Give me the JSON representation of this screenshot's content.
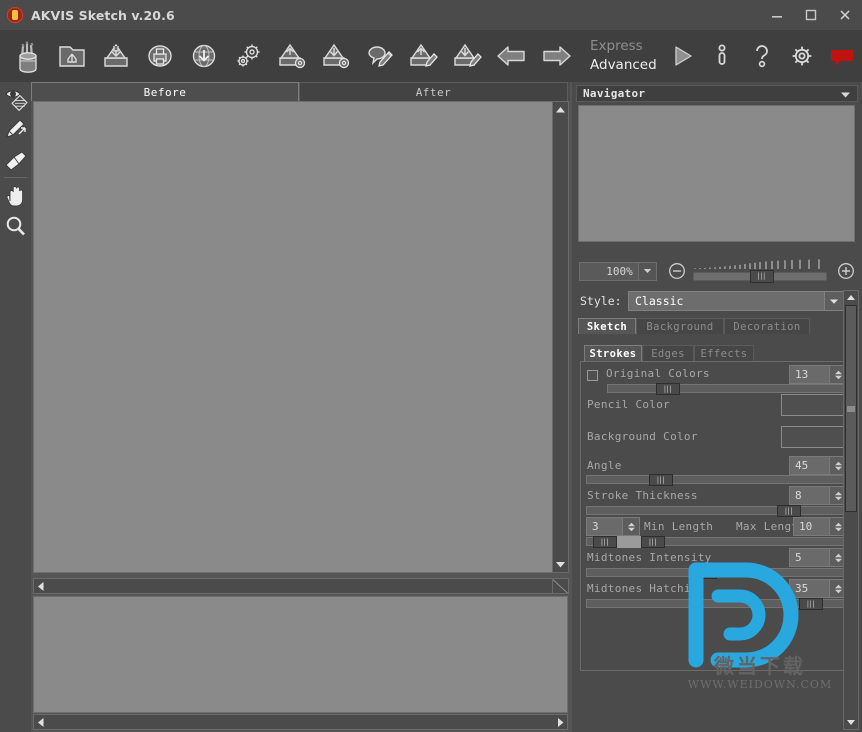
{
  "window": {
    "title": "AKVIS Sketch v.20.6",
    "icon": "akvis-logo-icon",
    "minimize": "minimize-icon",
    "maximize": "maximize-icon",
    "close": "close-icon"
  },
  "toolbar": {
    "buttons": [
      {
        "name": "pencil-cup-icon",
        "label": "Tools"
      },
      {
        "name": "open-image-icon",
        "label": "Open Image"
      },
      {
        "name": "save-image-icon",
        "label": "Save Image"
      },
      {
        "name": "print-image-icon",
        "label": "Print Image"
      },
      {
        "name": "download-web-icon",
        "label": "Publish to Web"
      },
      {
        "name": "preferences-gears-icon",
        "label": "Preferences"
      },
      {
        "name": "load-preset-icon",
        "label": "Load Preset"
      },
      {
        "name": "save-preset-icon",
        "label": "Save Preset"
      },
      {
        "name": "comment-brush-icon",
        "label": "Comment"
      },
      {
        "name": "load-strokes-icon",
        "label": "Load Strokes"
      },
      {
        "name": "save-strokes-icon",
        "label": "Save Strokes"
      },
      {
        "name": "undo-arrow-icon",
        "label": "Undo"
      },
      {
        "name": "redo-arrow-icon",
        "label": "Redo"
      }
    ],
    "mode_express": "Express",
    "mode_advanced": "Advanced",
    "right_buttons": [
      {
        "name": "run-play-icon",
        "label": "Run"
      },
      {
        "name": "info-icon",
        "label": "About"
      },
      {
        "name": "help-question-icon",
        "label": "Help"
      },
      {
        "name": "settings-gear-icon",
        "label": "Settings"
      },
      {
        "name": "comments-icon",
        "label": "Comments"
      }
    ]
  },
  "left_tools": [
    {
      "name": "preview-eye-icon",
      "label": "Quick Preview"
    },
    {
      "name": "direction-brush-icon",
      "label": "Direction Brush"
    },
    {
      "name": "eraser-icon",
      "label": "Eraser"
    },
    {
      "name": "hand-icon",
      "label": "Hand"
    },
    {
      "name": "zoom-magnifier-icon",
      "label": "Zoom"
    }
  ],
  "image_tabs": [
    {
      "label": "Before",
      "active": true
    },
    {
      "label": "After",
      "active": false
    }
  ],
  "navigator": {
    "title": "Navigator",
    "collapse_icon": "chevron-down-icon",
    "zoom_value": "100%",
    "zoom_out_icon": "minus-circle-icon",
    "zoom_in_icon": "plus-circle-icon",
    "dropdown_icon": "chevron-down-icon"
  },
  "settings": {
    "style_label": "Style:",
    "style_value": "Classic",
    "main_tabs": [
      {
        "label": "Sketch",
        "active": true
      },
      {
        "label": "Background",
        "active": false
      },
      {
        "label": "Decoration",
        "active": false
      }
    ],
    "sub_tabs": [
      {
        "label": "Strokes",
        "active": true
      },
      {
        "label": "Edges",
        "active": false
      },
      {
        "label": "Effects",
        "active": false
      }
    ],
    "params": [
      {
        "name": "original-colors",
        "label": "Original Colors",
        "type": "checkbox-slider",
        "value": "13",
        "checked": false
      },
      {
        "name": "pencil-color",
        "label": "Pencil Color",
        "type": "color"
      },
      {
        "name": "background-color",
        "label": "Background Color",
        "type": "color"
      },
      {
        "name": "angle",
        "label": "Angle",
        "type": "slider",
        "value": "45"
      },
      {
        "name": "stroke-thickness",
        "label": "Stroke Thickness",
        "type": "slider",
        "value": "8"
      },
      {
        "name": "min-length",
        "label": "Min Length",
        "type": "range-min",
        "value": "3"
      },
      {
        "name": "max-length",
        "label": "Max Length",
        "type": "range-max",
        "value": "10"
      },
      {
        "name": "midtones-intensity",
        "label": "Midtones Intensity",
        "type": "slider",
        "value": "5"
      },
      {
        "name": "midtones-hatching",
        "label": "Midtones Hatching",
        "type": "slider",
        "value": "35"
      }
    ]
  },
  "watermark": {
    "logo": "weidown-d-logo",
    "cn_text": "微当下载",
    "site": "WWW.WEIDOWN.COM"
  },
  "colors": {
    "titlebar": "#4b4b4b",
    "toolbar": "#3f3f3f",
    "panel": "#4b4b4b",
    "canvas": "#8a8a8a",
    "accent_red": "#a32216",
    "watermark_blue": "#2aa8e0"
  }
}
